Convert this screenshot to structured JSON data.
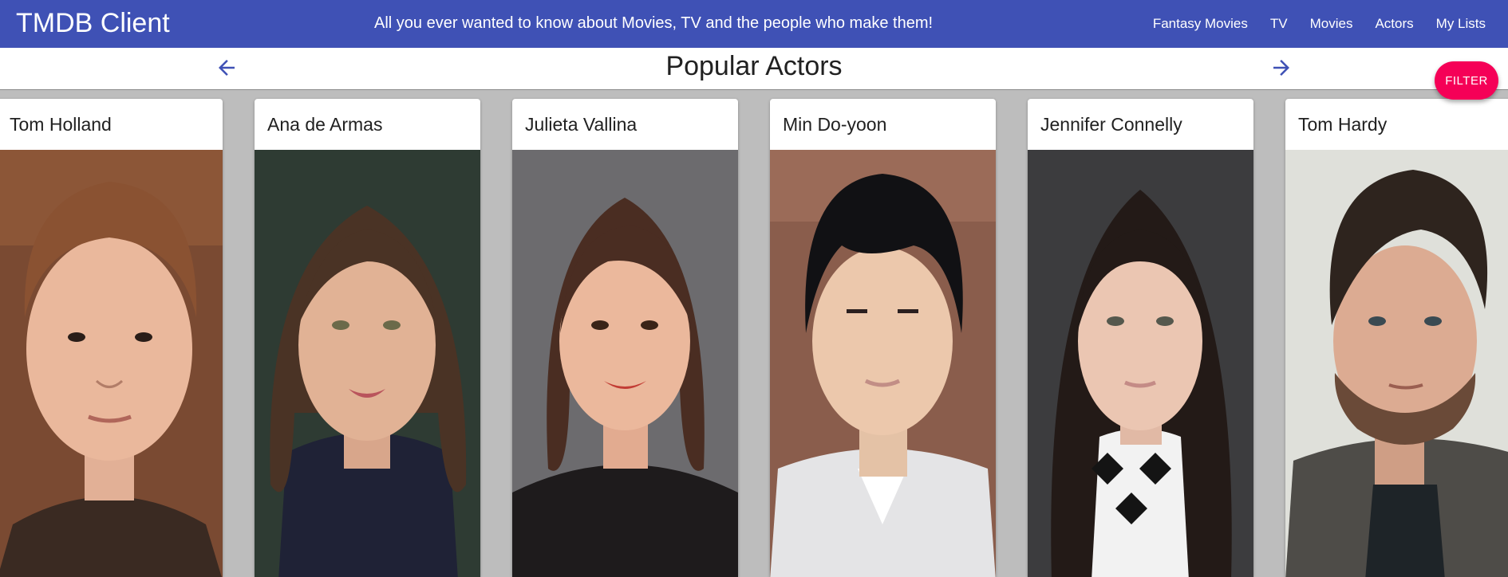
{
  "app": {
    "title": "TMDB Client",
    "tagline": "All you ever wanted to know about Movies, TV and the people who make them!"
  },
  "nav": {
    "links": [
      "Fantasy Movies",
      "TV",
      "Movies",
      "Actors",
      "My Lists"
    ]
  },
  "page": {
    "title": "Popular Actors",
    "prev_icon": "arrow-back-icon",
    "next_icon": "arrow-forward-icon",
    "filter_label": "FILTER"
  },
  "actors": [
    {
      "name": "Tom Holland"
    },
    {
      "name": "Ana de Armas"
    },
    {
      "name": "Julieta Vallina"
    },
    {
      "name": "Min Do-yoon"
    },
    {
      "name": "Jennifer Connelly"
    },
    {
      "name": "Tom Hardy"
    }
  ],
  "colors": {
    "primary": "#3f51b5",
    "accent": "#f50057",
    "page_background": "#bdbdbd"
  }
}
